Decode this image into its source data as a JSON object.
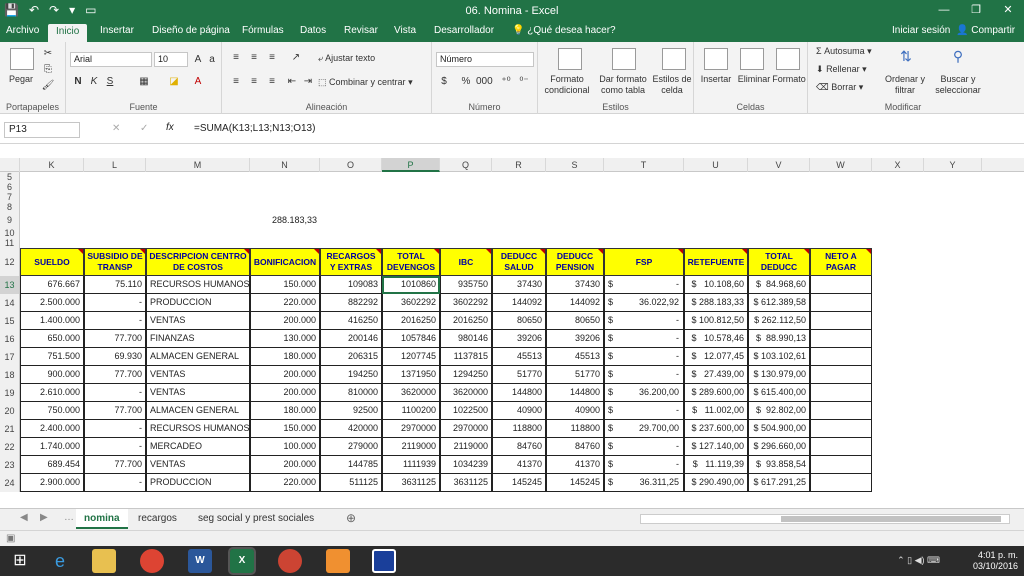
{
  "title": "06. Nomina - Excel",
  "window_controls": [
    "—",
    "❐",
    "✕"
  ],
  "tabs": [
    "Archivo",
    "Inicio",
    "Insertar",
    "Diseño de página",
    "Fórmulas",
    "Datos",
    "Revisar",
    "Vista",
    "Desarrollador",
    "¿Qué desea hacer?"
  ],
  "account": {
    "signin": "Iniciar sesión",
    "share": "Compartir"
  },
  "ribbon": {
    "paste": "Pegar",
    "clipboard": "Portapapeles",
    "font_name": "Arial",
    "font_size": "10",
    "font_group": "Fuente",
    "wrap": "Ajustar texto",
    "merge": "Combinar y centrar",
    "align_group": "Alineación",
    "numfmt": "Número",
    "num_group": "Número",
    "cond": "Formato condicional",
    "fmt_table": "Dar formato como tabla",
    "cell_styles": "Estilos de celda",
    "styles_group": "Estilos",
    "insert": "Insertar",
    "delete": "Eliminar",
    "format": "Formato",
    "cells_group": "Celdas",
    "autosum": "Autosuma",
    "fill": "Rellenar",
    "clear": "Borrar",
    "sort": "Ordenar y filtrar",
    "find": "Buscar y seleccionar",
    "modify_group": "Modificar"
  },
  "namebox": "P13",
  "formula": "=SUMA(K13;L13;N13;O13)",
  "columns": [
    "K",
    "L",
    "M",
    "N",
    "O",
    "P",
    "Q",
    "R",
    "S",
    "T",
    "U",
    "V",
    "W",
    "X",
    "Y"
  ],
  "empty_rows": [
    "5",
    "6",
    "7",
    "8",
    "9",
    "10",
    "11"
  ],
  "n9_value": "288.183,33",
  "headers": [
    "SUELDO",
    "SUBSIDIO DE TRANSP",
    "DESCRIPCION CENTRO DE COSTOS",
    "BONIFICACION",
    "RECARGOS Y EXTRAS",
    "TOTAL DEVENGOS",
    "IBC",
    "DEDUCC SALUD",
    "DEDUCC PENSION",
    "FSP",
    "RETEFUENTE",
    "TOTAL DEDUCC",
    "NETO A PAGAR"
  ],
  "rows": [
    {
      "n": "13",
      "k": "676.667",
      "l": "75.110",
      "m": "RECURSOS HUMANOS",
      "nb": "150.000",
      "o": "109083",
      "p": "1010860",
      "q": "935750",
      "r": "37430",
      "s": "37430",
      "t1": "$",
      "t2": "-",
      "u": "$   10.108,60",
      "v": "$  84.968,60"
    },
    {
      "n": "14",
      "k": "2.500.000",
      "l": "-",
      "m": "PRODUCCION",
      "nb": "220.000",
      "o": "882292",
      "p": "3602292",
      "q": "3602292",
      "r": "144092",
      "s": "144092",
      "t1": "$",
      "t2": "36.022,92",
      "u": "$ 288.183,33",
      "v": "$ 612.389,58"
    },
    {
      "n": "15",
      "k": "1.400.000",
      "l": "-",
      "m": "VENTAS",
      "nb": "200.000",
      "o": "416250",
      "p": "2016250",
      "q": "2016250",
      "r": "80650",
      "s": "80650",
      "t1": "$",
      "t2": "-",
      "u": "$ 100.812,50",
      "v": "$ 262.112,50"
    },
    {
      "n": "16",
      "k": "650.000",
      "l": "77.700",
      "m": "FINANZAS",
      "nb": "130.000",
      "o": "200146",
      "p": "1057846",
      "q": "980146",
      "r": "39206",
      "s": "39206",
      "t1": "$",
      "t2": "-",
      "u": "$   10.578,46",
      "v": "$  88.990,13"
    },
    {
      "n": "17",
      "k": "751.500",
      "l": "69.930",
      "m": "ALMACEN GENERAL",
      "nb": "180.000",
      "o": "206315",
      "p": "1207745",
      "q": "1137815",
      "r": "45513",
      "s": "45513",
      "t1": "$",
      "t2": "-",
      "u": "$   12.077,45",
      "v": "$ 103.102,61"
    },
    {
      "n": "18",
      "k": "900.000",
      "l": "77.700",
      "m": "VENTAS",
      "nb": "200.000",
      "o": "194250",
      "p": "1371950",
      "q": "1294250",
      "r": "51770",
      "s": "51770",
      "t1": "$",
      "t2": "-",
      "u": "$   27.439,00",
      "v": "$ 130.979,00"
    },
    {
      "n": "19",
      "k": "2.610.000",
      "l": "-",
      "m": "VENTAS",
      "nb": "200.000",
      "o": "810000",
      "p": "3620000",
      "q": "3620000",
      "r": "144800",
      "s": "144800",
      "t1": "$",
      "t2": "36.200,00",
      "u": "$ 289.600,00",
      "v": "$ 615.400,00"
    },
    {
      "n": "20",
      "k": "750.000",
      "l": "77.700",
      "m": "ALMACEN GENERAL",
      "nb": "180.000",
      "o": "92500",
      "p": "1100200",
      "q": "1022500",
      "r": "40900",
      "s": "40900",
      "t1": "$",
      "t2": "-",
      "u": "$   11.002,00",
      "v": "$  92.802,00"
    },
    {
      "n": "21",
      "k": "2.400.000",
      "l": "-",
      "m": "RECURSOS HUMANOS",
      "nb": "150.000",
      "o": "420000",
      "p": "2970000",
      "q": "2970000",
      "r": "118800",
      "s": "118800",
      "t1": "$",
      "t2": "29.700,00",
      "u": "$ 237.600,00",
      "v": "$ 504.900,00"
    },
    {
      "n": "22",
      "k": "1.740.000",
      "l": "-",
      "m": "MERCADEO",
      "nb": "100.000",
      "o": "279000",
      "p": "2119000",
      "q": "2119000",
      "r": "84760",
      "s": "84760",
      "t1": "$",
      "t2": "-",
      "u": "$ 127.140,00",
      "v": "$ 296.660,00"
    },
    {
      "n": "23",
      "k": "689.454",
      "l": "77.700",
      "m": "VENTAS",
      "nb": "200.000",
      "o": "144785",
      "p": "1111939",
      "q": "1034239",
      "r": "41370",
      "s": "41370",
      "t1": "$",
      "t2": "-",
      "u": "$   11.119,39",
      "v": "$  93.858,54"
    },
    {
      "n": "24",
      "k": "2.900.000",
      "l": "-",
      "m": "PRODUCCION",
      "nb": "220.000",
      "o": "511125",
      "p": "3631125",
      "q": "3631125",
      "r": "145245",
      "s": "145245",
      "t1": "$",
      "t2": "36.311,25",
      "u": "$ 290.490,00",
      "v": "$ 617.291,25"
    }
  ],
  "header_row": "12",
  "sheets": [
    "nomina",
    "recargos",
    "seg social y prest sociales"
  ],
  "clock": {
    "time": "4:01 p. m.",
    "date": "03/10/2016"
  },
  "colors": {
    "excel_green": "#217346",
    "header_yellow": "#ffff00"
  }
}
